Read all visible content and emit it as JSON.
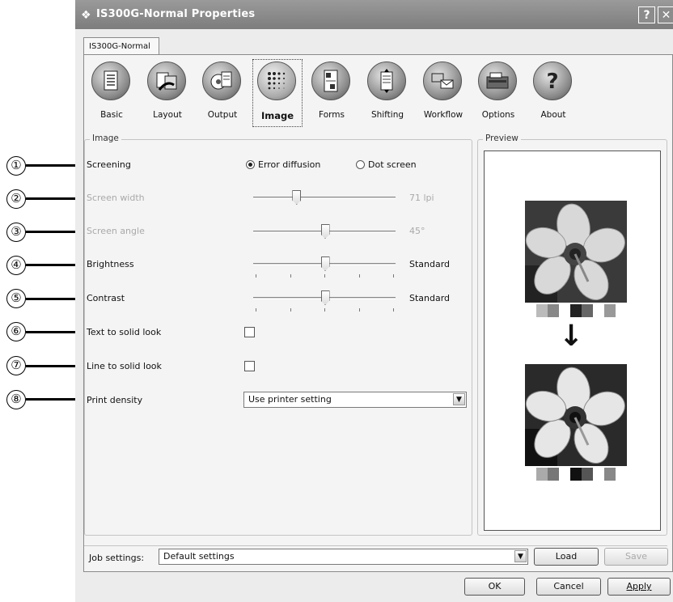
{
  "window": {
    "title": "IS300G-Normal Properties",
    "help_btn": "?",
    "close_btn": "✕",
    "tab": "IS300G-Normal"
  },
  "toolbar": {
    "items": [
      {
        "label": "Basic",
        "icon": "document-icon"
      },
      {
        "label": "Layout",
        "icon": "layout-icon"
      },
      {
        "label": "Output",
        "icon": "output-icon"
      },
      {
        "label": "Image",
        "icon": "halftone-icon"
      },
      {
        "label": "Forms",
        "icon": "forms-icon"
      },
      {
        "label": "Shifting",
        "icon": "shifting-icon"
      },
      {
        "label": "Workflow",
        "icon": "workflow-icon"
      },
      {
        "label": "Options",
        "icon": "printer-options-icon"
      },
      {
        "label": "About",
        "icon": "question-icon"
      }
    ],
    "selected": "Image"
  },
  "image_group": {
    "title": "Image",
    "screening": {
      "label": "Screening",
      "option1": "Error diffusion",
      "option2": "Dot screen",
      "selected": "Error diffusion"
    },
    "screen_width": {
      "label": "Screen width",
      "value": "71 lpi",
      "level": 0.3
    },
    "screen_angle": {
      "label": "Screen angle",
      "value": "45°",
      "level": 0.5
    },
    "brightness": {
      "label": "Brightness",
      "value": "Standard",
      "level": 0.5
    },
    "contrast": {
      "label": "Contrast",
      "value": "Standard",
      "level": 0.5
    },
    "text_solid": {
      "label": "Text to solid look",
      "checked": false
    },
    "line_solid": {
      "label": "Line to solid look",
      "checked": false
    },
    "print_density": {
      "label": "Print density",
      "value": "Use printer setting"
    }
  },
  "preview": {
    "title": "Preview",
    "arrow": "↓"
  },
  "job_settings": {
    "label": "Job settings:",
    "value": "Default settings",
    "load": "Load",
    "save": "Save"
  },
  "footer": {
    "ok": "OK",
    "cancel": "Cancel",
    "apply": "Apply"
  },
  "callouts": [
    "①",
    "②",
    "③",
    "④",
    "⑤",
    "⑥",
    "⑦",
    "⑧"
  ],
  "colors": {
    "titlebar": "#8a8a8a",
    "panel": "#f4f4f4"
  }
}
